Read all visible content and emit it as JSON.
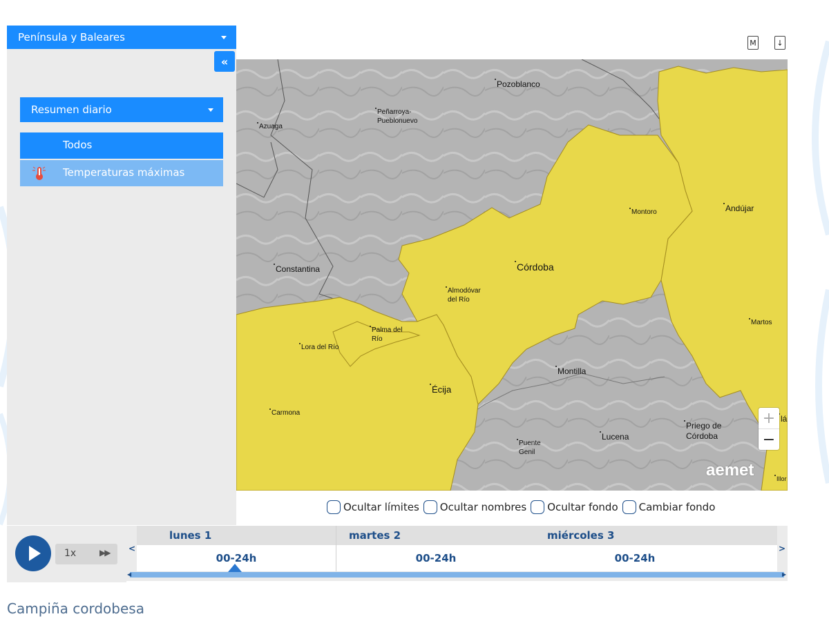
{
  "region_select": {
    "label": "Península y Baleares"
  },
  "collapse_button": {
    "label": "«"
  },
  "summary_select": {
    "label": "Resumen diario"
  },
  "list": {
    "items": [
      {
        "label": "Todos"
      },
      {
        "label": "Temperaturas máximas",
        "icon": "thermometer-icon"
      }
    ]
  },
  "top_icons": {
    "m_label": "M",
    "download_label": "↓"
  },
  "map": {
    "cities": [
      {
        "name": "Pozoblanco"
      },
      {
        "name": "Peñarroya-\nPueblonuevo"
      },
      {
        "name": "Azuaga"
      },
      {
        "name": "Montoro"
      },
      {
        "name": "Andújar"
      },
      {
        "name": "Córdoba"
      },
      {
        "name": "Constantina"
      },
      {
        "name": "Almodóvar\ndel Río"
      },
      {
        "name": "Palma del\nRío"
      },
      {
        "name": "Lora del Río"
      },
      {
        "name": "Martos"
      },
      {
        "name": "Écija"
      },
      {
        "name": "Montilla"
      },
      {
        "name": "Carmona"
      },
      {
        "name": "Puente\nGenil"
      },
      {
        "name": "Lucena"
      },
      {
        "name": "Priego de\nCórdoba"
      },
      {
        "name": "lá"
      },
      {
        "name": "Illor"
      }
    ],
    "zoom_in": "+",
    "zoom_out": "−",
    "logo": "aemet",
    "colors": {
      "warning_yellow": "#e8d84a",
      "terrain_gray": "#b4b4b4"
    }
  },
  "checkboxes": [
    {
      "label": "Ocultar límites",
      "checked": false
    },
    {
      "label": "Ocultar nombres",
      "checked": false
    },
    {
      "label": "Ocultar fondo",
      "checked": false
    },
    {
      "label": "Cambiar fondo",
      "checked": false
    }
  ],
  "player": {
    "speed": "1x",
    "ff_icon": "fast-forward-icon"
  },
  "timeline": {
    "prev": "<",
    "next": ">",
    "days": [
      {
        "day": "lunes 1",
        "period": "00-24h",
        "selected": true
      },
      {
        "day": "martes 2",
        "period": "00-24h"
      },
      {
        "day": "miércoles 3",
        "period": "00-24h"
      }
    ]
  },
  "zone_title": "Campiña cordobesa"
}
